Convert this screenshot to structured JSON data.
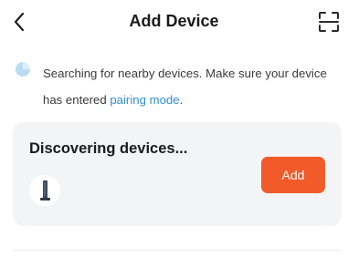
{
  "header": {
    "title": "Add Device",
    "back_icon": "chevron-left-icon",
    "scan_icon": "scan-icon"
  },
  "search_hint": {
    "icon": "search-spinner-icon",
    "text_before": "Searching for nearby devices. Make sure your device has entered ",
    "link_text": "pairing mode",
    "text_after": "."
  },
  "discovery_card": {
    "title": "Discovering devices...",
    "device_icon": "device-lamp-icon",
    "add_label": "Add"
  },
  "colors": {
    "accent": "#f15a29",
    "link": "#2f8fdc",
    "card_bg": "#f3f4f6",
    "spinner": "#b9dcf5"
  }
}
